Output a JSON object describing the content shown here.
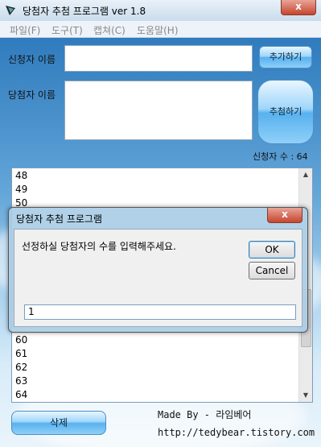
{
  "window": {
    "title": "당첨자 추첨 프로그램 ver 1.8",
    "close_label": "x"
  },
  "menu": [
    "파일(F)",
    "도구(T)",
    "캡쳐(C)",
    "도움말(H)"
  ],
  "form": {
    "applicant_label": "신청자 이름",
    "winner_label": "당첨자 이름",
    "add_button": "추가하기",
    "draw_button": "추첨하기",
    "count_label": "신청자 수 : 64",
    "delete_button": "삭제"
  },
  "list": {
    "items": [
      "48",
      "49",
      "50",
      "60",
      "61",
      "62",
      "63",
      "64"
    ]
  },
  "credits": {
    "made_by": "Made By - 라임베어",
    "url": "http://tedybear.tistory.com"
  },
  "dialog": {
    "title": "당첨자 추첨 프로그램",
    "close_label": "x",
    "message": "선정하실 당첨자의 수를 입력해주세요.",
    "ok_button": "OK",
    "cancel_button": "Cancel",
    "input_value": "1"
  },
  "colors": {
    "sky_top": "#2f7bbd",
    "glass_button": "#58b1ef",
    "close_red": "#c7452e"
  }
}
